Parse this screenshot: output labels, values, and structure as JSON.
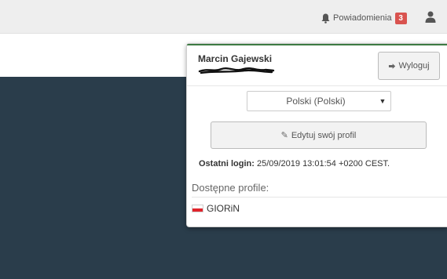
{
  "topbar": {
    "notifications_label": "Powiadomienia",
    "notifications_count": "3",
    "bell_icon": "bell-icon",
    "user_icon": "user-icon"
  },
  "user_panel": {
    "username": "Marcin Gajewski",
    "logout_label": "Wyloguj",
    "logout_icon": "sign-out-icon",
    "language": {
      "selected": "Polski (Polski)",
      "caret": "▼"
    },
    "edit_profile_label": "Edytuj swój profil",
    "edit_icon": "edit-icon",
    "last_login": {
      "label": "Ostatni login:",
      "value": "25/09/2019 13:01:54 +0200 CEST."
    },
    "profiles_title": "Dostępne profile:",
    "profiles": [
      {
        "name": "GIORiN",
        "flag": "poland-flag-icon"
      }
    ]
  },
  "colors": {
    "dark_background": "#2a3d4b",
    "badge": "#d9534f",
    "accent": "#3d7a43"
  }
}
